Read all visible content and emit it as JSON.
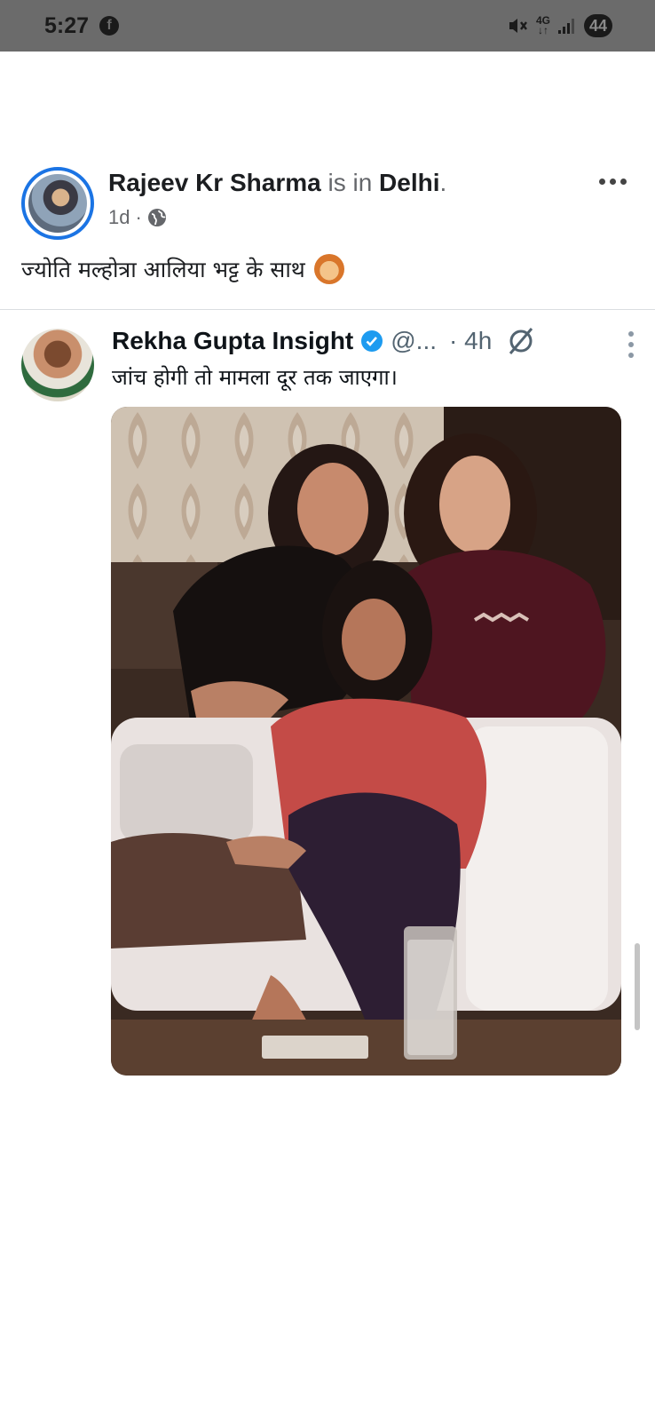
{
  "status_bar": {
    "time": "5:27",
    "network": "4G",
    "battery": "44",
    "icons": [
      "facebook-icon",
      "mute-icon",
      "signal-icon"
    ]
  },
  "post": {
    "author": "Rajeev Kr Sharma",
    "location_prefix": "is in",
    "location": "Delhi",
    "location_suffix": ".",
    "time": "1d",
    "separator": "·",
    "privacy_icon": "globe-icon",
    "text": "ज्योति मल्होत्रा आलिया भट्ट के साथ",
    "emoji": "raising-hand-emoji"
  },
  "tweet": {
    "name": "Rekha Gupta Insight",
    "handle": "@...",
    "time": "· 4h",
    "text": "जांच होगी तो मामला दूर तक जाएगा।",
    "verified_color": "#1d9bf0"
  },
  "colors": {
    "status_bar_bg": "#6b6b6b",
    "avatar_ring": "#1b74e4",
    "muted_text": "#65676b"
  }
}
